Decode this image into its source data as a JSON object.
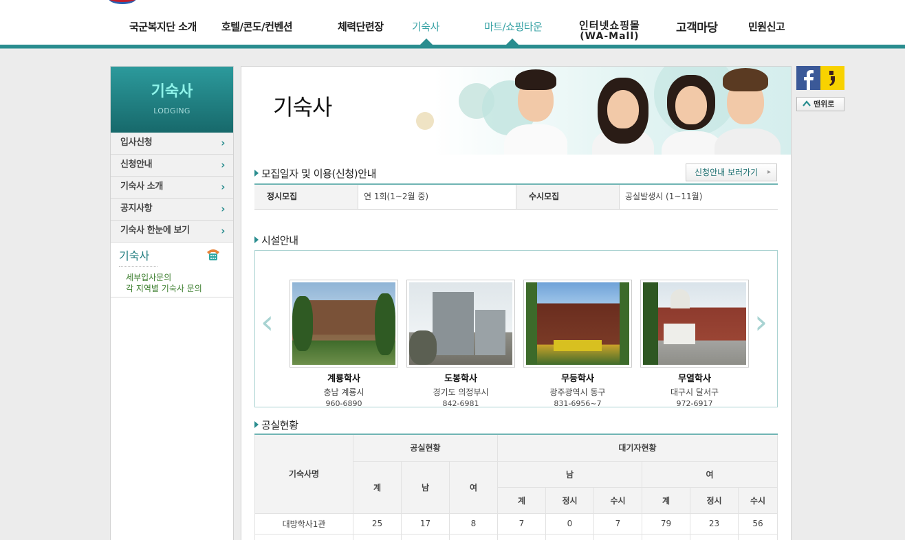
{
  "gnb": {
    "items": [
      {
        "label": "국군복지단 소개",
        "sub": ""
      },
      {
        "label": "호텔/콘도/컨벤션",
        "sub": ""
      },
      {
        "label": "체력단련장",
        "sub": ""
      },
      {
        "label": "기숙사",
        "sub": ""
      },
      {
        "label": "마트/쇼핑타운",
        "sub": ""
      },
      {
        "label": "인터넷쇼핑몰",
        "sub": "(WA-Mall)"
      },
      {
        "label": "고객마당",
        "sub": ""
      },
      {
        "label": "민원신고",
        "sub": ""
      }
    ]
  },
  "lnb": {
    "title": "기숙사",
    "subtitle": "LODGING",
    "items": [
      "입사신청",
      "신청안내",
      "기숙사 소개",
      "공지사항",
      "기숙사 한눈에 보기"
    ],
    "contact": {
      "title": "기숙사",
      "lines": [
        "세부입사문의",
        "각 지역별 기숙사 문의"
      ]
    }
  },
  "visual": {
    "title": "기숙사"
  },
  "recruit": {
    "section_title": "모집일자 및 이용(신청)안내",
    "guide_button": "신청안내 보러가기",
    "regular_label": "정시모집",
    "regular_value": "연 1회(1~2월 중)",
    "occasional_label": "수시모집",
    "occasional_value": "공실발생시 (1~11월)"
  },
  "facility": {
    "section_title": "시설안내",
    "dorms": [
      {
        "name": "계룡학사",
        "addr": "충남 계룡시",
        "tel": "960-6890"
      },
      {
        "name": "도봉학사",
        "addr": "경기도 의정부시",
        "tel": "842-6981"
      },
      {
        "name": "무등학사",
        "addr": "광주광역시 동구",
        "tel": "831-6956~7"
      },
      {
        "name": "무열학사",
        "addr": "대구시 달서구",
        "tel": "972-6917"
      }
    ]
  },
  "vacancy": {
    "section_title": "공실현황",
    "headers": {
      "dorm_name": "기숙사명",
      "vacancy": "공실현황",
      "waiting": "대기자현황",
      "male": "남",
      "female": "여",
      "total": "계",
      "regular": "정시",
      "occasional": "수시"
    },
    "rows": [
      {
        "name": "대방학사1관",
        "values": [
          "25",
          "17",
          "8",
          "7",
          "0",
          "7",
          "79",
          "23",
          "56"
        ]
      }
    ]
  },
  "quick": {
    "top_label": "맨위로"
  },
  "colors": {
    "accent": "#2a8d8f",
    "active_menu": "#3aa3a6",
    "lnb_title": "#8ff4ea"
  }
}
